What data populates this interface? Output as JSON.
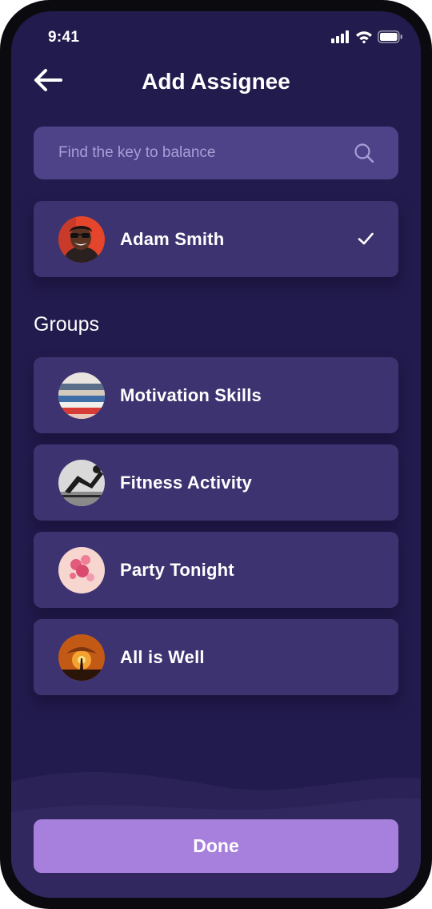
{
  "status_bar": {
    "time": "9:41",
    "icons": [
      "signal-icon",
      "wifi-icon",
      "battery-icon"
    ]
  },
  "header": {
    "title": "Add Assignee",
    "back_icon": "arrow-left-icon"
  },
  "search": {
    "placeholder": "Find the key to balance",
    "value": "",
    "icon": "search-icon"
  },
  "selected_user": {
    "name": "Adam Smith",
    "selected": true,
    "check_icon": "checkmark-icon"
  },
  "groups": {
    "heading": "Groups",
    "items": [
      {
        "label": "Motivation Skills"
      },
      {
        "label": "Fitness Activity"
      },
      {
        "label": "Party Tonight"
      },
      {
        "label": "All is Well"
      }
    ]
  },
  "footer": {
    "done_label": "Done"
  },
  "colors": {
    "background": "#221b4d",
    "card": "#3d3370",
    "search_field": "#4e4289",
    "accent": "#a77fdc",
    "text": "#ffffff",
    "placeholder": "#a99ed6"
  }
}
